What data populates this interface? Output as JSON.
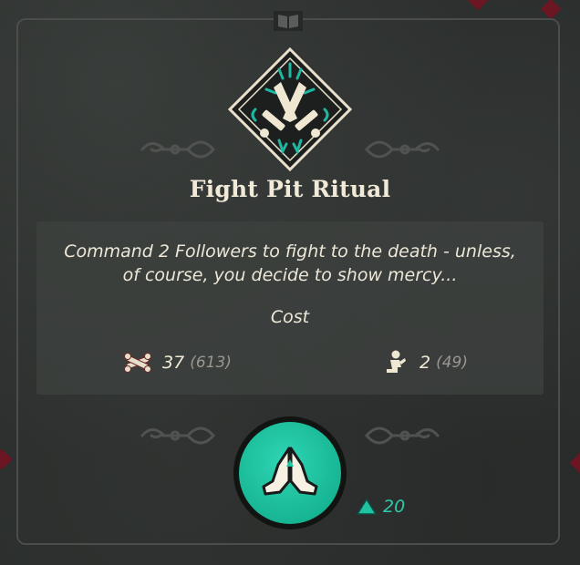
{
  "ritual": {
    "title": "Fight Pit Ritual",
    "description_line1": "Command 2 Followers to fight to the death - unless,",
    "description_line2": "of course, you decide to show mercy...",
    "cost_label": "Cost"
  },
  "costs": [
    {
      "icon": "bones-icon",
      "amount": "37",
      "total": "(613)"
    },
    {
      "icon": "follower-kneeling-icon",
      "amount": "2",
      "total": "(49)"
    }
  ],
  "action": {
    "icon": "praying-hands-icon",
    "devotion_icon": "triangle-up-icon",
    "devotion_value": "20"
  },
  "colors": {
    "accent_teal": "#1fc4a2",
    "text_cream": "#f1ead8",
    "text_muted": "#9a9690",
    "panel_bg": "#3e413f"
  }
}
